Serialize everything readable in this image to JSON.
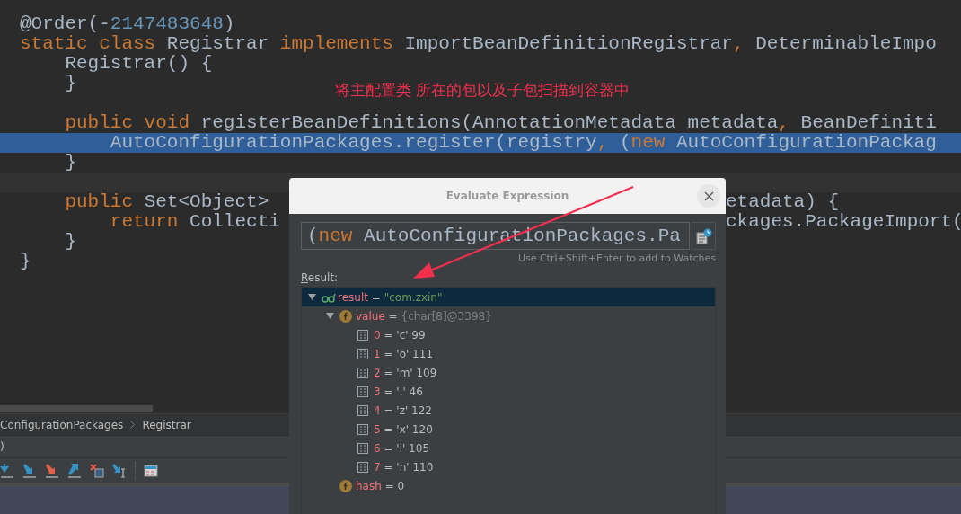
{
  "editor": {
    "lines": [
      {
        "kind": "plain",
        "tokens": [
          {
            "text": "@Order(-",
            "kind": "plain"
          },
          {
            "text": "2147483648",
            "kind": "number"
          },
          {
            "text": ")",
            "kind": "plain"
          }
        ]
      },
      {
        "kind": "plain",
        "tokens": [
          {
            "text": "static class ",
            "kind": "keyword"
          },
          {
            "text": "Registrar ",
            "kind": "plain"
          },
          {
            "text": "implements ",
            "kind": "keyword"
          },
          {
            "text": "ImportBeanDefinitionRegistrar",
            "kind": "plain"
          },
          {
            "text": ",",
            "kind": "keyword"
          },
          {
            "text": " DeterminableImpo",
            "kind": "plain"
          }
        ]
      },
      {
        "kind": "plain",
        "tokens": [
          {
            "text": "    Registrar() {",
            "kind": "plain"
          }
        ]
      },
      {
        "kind": "plain",
        "tokens": [
          {
            "text": "    }",
            "kind": "plain"
          }
        ]
      },
      {
        "kind": "plain"
      },
      {
        "kind": "plain",
        "tokens": [
          {
            "text": "    public void ",
            "kind": "keyword"
          },
          {
            "text": "registerBeanDefinitions(AnnotationMetadata metadata",
            "kind": "plain"
          },
          {
            "text": ",",
            "kind": "keyword"
          },
          {
            "text": " BeanDefiniti",
            "kind": "plain"
          }
        ]
      },
      {
        "kind": "execution",
        "tokens": [
          {
            "text": "        AutoConfigurationPackages.register(registry",
            "kind": "plain"
          },
          {
            "text": ",",
            "kind": "keyword"
          },
          {
            "text": " (",
            "kind": "plain"
          },
          {
            "text": "new",
            "kind": "keyword"
          },
          {
            "text": " AutoConfigurationPackag",
            "kind": "plain"
          }
        ]
      },
      {
        "kind": "plain",
        "tokens": [
          {
            "text": "    }",
            "kind": "plain"
          }
        ]
      },
      {
        "kind": "caret"
      },
      {
        "kind": "plain",
        "tokens": [
          {
            "text": "    public ",
            "kind": "keyword"
          },
          {
            "text": "Set<Object> ",
            "kind": "plain"
          }
        ],
        "right": [
          {
            "text": "etadata) {",
            "kind": "plain"
          }
        ]
      },
      {
        "kind": "plain",
        "tokens": [
          {
            "text": "        return ",
            "kind": "keyword"
          },
          {
            "text": "Collecti",
            "kind": "plain"
          }
        ],
        "right": [
          {
            "text": "ckages.PackageImport(",
            "kind": "plain"
          }
        ]
      },
      {
        "kind": "plain",
        "tokens": [
          {
            "text": "    }",
            "kind": "plain"
          }
        ]
      },
      {
        "kind": "plain",
        "tokens": [
          {
            "text": "}",
            "kind": "plain"
          }
        ]
      }
    ]
  },
  "annotation": {
    "text": "将主配置类 所在的包以及子包扫描到容器中"
  },
  "breadcrumbs": [
    "ConfigurationPackages",
    "Registrar"
  ],
  "status_text": ")",
  "dialog": {
    "title": "Evaluate Expression",
    "expression": [
      {
        "text": "(",
        "kind": "plain"
      },
      {
        "text": "new",
        "kind": "keyword"
      },
      {
        "text": " AutoConfigurationPackages.Pa",
        "kind": "plain"
      }
    ],
    "hint": "Use Ctrl+Shift+Enter to add to Watches",
    "result_label": "Result:",
    "tree": [
      {
        "kind": "watch",
        "name": "result",
        "operator": "=",
        "value": "\"com.zxin\"",
        "color": "#6a9955",
        "selected": true,
        "expanded": true,
        "children": [
          {
            "kind": "field",
            "name": "value",
            "operator": "=",
            "value": "{char[8]@3398}",
            "color": "#808080",
            "selected": false,
            "expanded": true,
            "children": [
              {
                "kind": "element",
                "name": "0",
                "operator": "=",
                "value": "'c' 99",
                "color": "#bbbbbb",
                "selected": false
              },
              {
                "kind": "element",
                "name": "1",
                "operator": "=",
                "value": "'o' 111",
                "color": "#bbbbbb",
                "selected": false
              },
              {
                "kind": "element",
                "name": "2",
                "operator": "=",
                "value": "'m' 109",
                "color": "#bbbbbb",
                "selected": false
              },
              {
                "kind": "element",
                "name": "3",
                "operator": "=",
                "value": "'.' 46",
                "color": "#bbbbbb",
                "selected": false
              },
              {
                "kind": "element",
                "name": "4",
                "operator": "=",
                "value": "'z' 122",
                "color": "#bbbbbb",
                "selected": false
              },
              {
                "kind": "element",
                "name": "5",
                "operator": "=",
                "value": "'x' 120",
                "color": "#bbbbbb",
                "selected": false
              },
              {
                "kind": "element",
                "name": "6",
                "operator": "=",
                "value": "'i' 105",
                "color": "#bbbbbb",
                "selected": false
              },
              {
                "kind": "element",
                "name": "7",
                "operator": "=",
                "value": "'n' 110",
                "color": "#bbbbbb",
                "selected": false
              }
            ]
          },
          {
            "kind": "field",
            "name": "hash",
            "operator": "=",
            "value": "0",
            "color": "#bbbbbb",
            "selected": false
          }
        ]
      }
    ]
  }
}
